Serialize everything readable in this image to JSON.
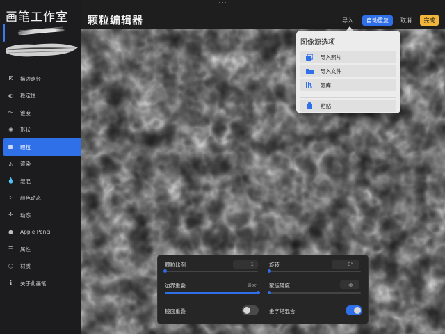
{
  "sidebar": {
    "title": "画笔工作室",
    "items": [
      {
        "label": "描边路径",
        "icon": "stroke-path-icon",
        "glyph": "ⴽ",
        "active": false
      },
      {
        "label": "稳定性",
        "icon": "stabilization-icon",
        "glyph": "◐",
        "active": false
      },
      {
        "label": "锥度",
        "icon": "taper-icon",
        "glyph": "〜",
        "active": false
      },
      {
        "label": "形状",
        "icon": "shape-icon",
        "glyph": "✺",
        "active": false
      },
      {
        "label": "颗粒",
        "icon": "grain-icon",
        "glyph": "▦",
        "active": true
      },
      {
        "label": "渲染",
        "icon": "rendering-icon",
        "glyph": "◭",
        "active": false
      },
      {
        "label": "湿混",
        "icon": "wet-mix-icon",
        "glyph": "💧",
        "active": false
      },
      {
        "label": "颜色动态",
        "icon": "color-dynamics-icon",
        "glyph": "⁘",
        "active": false
      },
      {
        "label": "动态",
        "icon": "dynamics-icon",
        "glyph": "✢",
        "active": false
      },
      {
        "label": "Apple Pencil",
        "icon": "apple-pencil-icon",
        "glyph": "●",
        "active": false
      },
      {
        "label": "属性",
        "icon": "properties-icon",
        "glyph": "☰",
        "active": false
      },
      {
        "label": "材质",
        "icon": "materials-icon",
        "glyph": "⬡",
        "active": false
      },
      {
        "label": "关于此画笔",
        "icon": "about-brush-icon",
        "glyph": "ℹ",
        "active": false
      }
    ]
  },
  "editor": {
    "title": "颗粒编辑器",
    "import_label": "导入",
    "autorepeat_label": "自动重复",
    "cancel_label": "取消",
    "done_label": "完成"
  },
  "popup": {
    "title": "图像源选项",
    "items": [
      {
        "label": "导入照片",
        "icon": "photos-icon"
      },
      {
        "label": "导入文件",
        "icon": "folder-icon"
      },
      {
        "label": "源库",
        "icon": "library-icon"
      },
      {
        "label": "粘贴",
        "icon": "paste-icon"
      }
    ]
  },
  "panel": {
    "grain_scale": {
      "label": "颗粒比例",
      "value": "1",
      "level": 0.0
    },
    "rotation": {
      "label": "旋转",
      "value": "0°",
      "level": 0.0
    },
    "edge_overlap": {
      "label": "边界重叠",
      "value": "最大",
      "level": 1.0
    },
    "mask_hardness": {
      "label": "蒙版硬度",
      "value": "柔",
      "level": 0.0
    },
    "mirror_overlap": {
      "label": "镜面重叠",
      "on": false
    },
    "pyramid_blend": {
      "label": "金字塔混合",
      "on": true
    }
  },
  "colors": {
    "accent": "#2f6fe8",
    "done": "#f1b63a",
    "sidebar_bg": "#1c1c1e",
    "popup_bg": "#ececec"
  }
}
